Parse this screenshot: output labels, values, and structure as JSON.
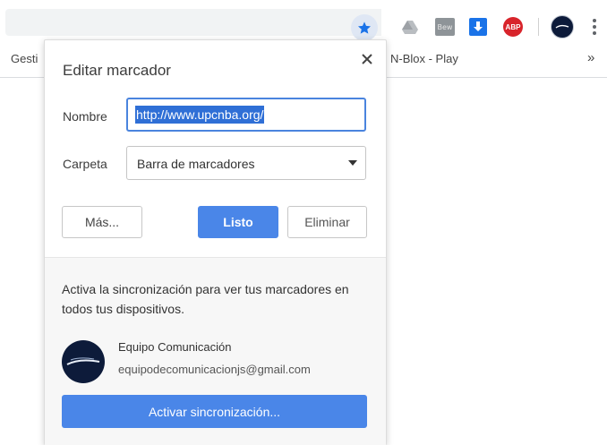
{
  "bookmarks_bar": {
    "items": [
      {
        "label": "Gesti"
      },
      {
        "label": "N-Blox - Play"
      }
    ],
    "overflow_label": "»"
  },
  "toolbar": {
    "icons": [
      "bookmark-star-icon",
      "drive-icon",
      "bw-extension-icon",
      "download-icon",
      "adblock-plus-icon",
      "profile-avatar",
      "menu-icon"
    ],
    "bw_text": "Bew",
    "abp_text": "ABP",
    "accent": "#1a73e8"
  },
  "dialog": {
    "title": "Editar marcador",
    "name_label": "Nombre",
    "name_value": "http://www.upcnba.org/",
    "folder_label": "Carpeta",
    "folder_value": "Barra de marcadores",
    "more_button": "Más...",
    "done_button": "Listo",
    "delete_button": "Eliminar",
    "sync_message": "Activa la sincronización para ver tus marcadores en todos tus dispositivos.",
    "account_name": "Equipo Comunicación",
    "account_email": "equipodecomunicacionjs@gmail.com",
    "sync_button": "Activar sincronización...",
    "primary_color": "#4a86e8"
  }
}
